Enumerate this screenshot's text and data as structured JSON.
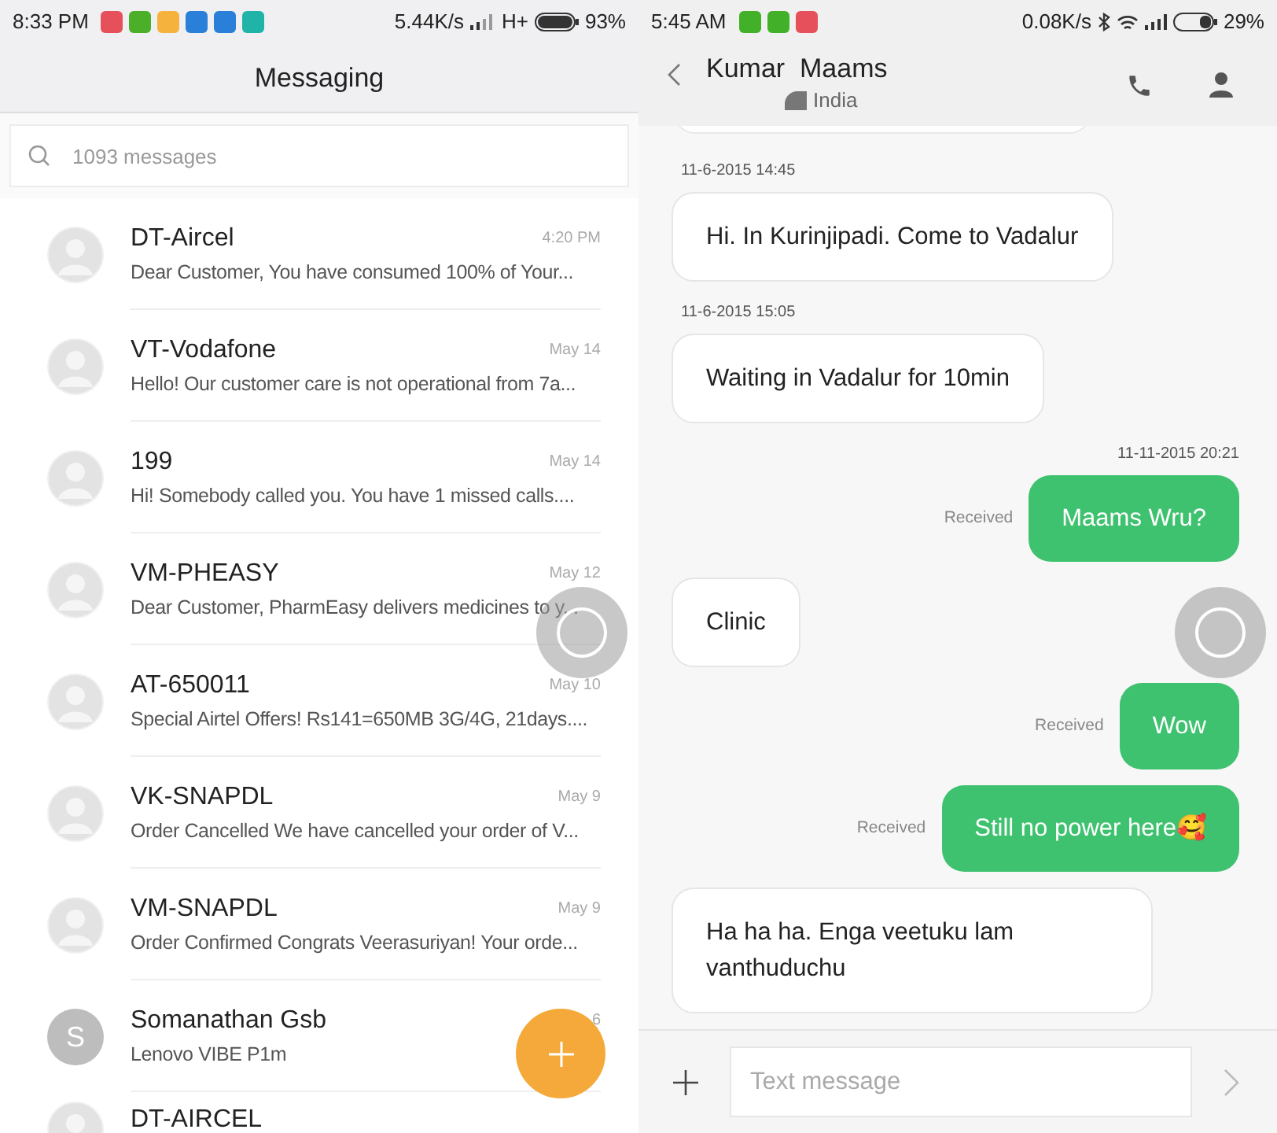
{
  "left_status_bar": {
    "time": "8:33 PM",
    "speed": "5.44K/s",
    "network": "H+",
    "battery": "93%"
  },
  "left_header": {
    "title": "Messaging"
  },
  "search": {
    "placeholder": "1093 messages"
  },
  "conversations": [
    {
      "kind": "silhouette",
      "name": "DT-Aircel",
      "time": "4:20 PM",
      "preview": "Dear Customer, You have consumed 100% of Your..."
    },
    {
      "kind": "silhouette",
      "name": "VT-Vodafone",
      "time": "May 14",
      "preview": "Hello! Our customer care is not operational from 7a..."
    },
    {
      "kind": "silhouette",
      "name": "199",
      "time": "May 14",
      "preview": "Hi! Somebody called you. You have 1 missed calls...."
    },
    {
      "kind": "silhouette",
      "name": "VM-PHEASY",
      "time": "May 12",
      "preview": "Dear Customer, PharmEasy delivers medicines to y..."
    },
    {
      "kind": "silhouette",
      "name": "AT-650011",
      "time": "May 10",
      "preview": "Special Airtel Offers! Rs141=650MB 3G/4G, 21days...."
    },
    {
      "kind": "silhouette",
      "name": "VK-SNAPDL",
      "time": "May 9",
      "preview": "Order Cancelled We have cancelled your order of V..."
    },
    {
      "kind": "silhouette",
      "name": "VM-SNAPDL",
      "time": "May 9",
      "preview": "Order Confirmed Congrats Veerasuriyan! Your orde..."
    },
    {
      "kind": "letter",
      "letter": "S",
      "name": "Somanathan Gsb",
      "time": "6",
      "preview": "Lenovo VIBE P1m"
    },
    {
      "kind": "silhouette",
      "name": "DT-AIRCEL"
    }
  ],
  "right_status_bar": {
    "time": "5:45 AM",
    "speed": "0.08K/s",
    "battery": "29%"
  },
  "contact": {
    "name": "Kumar  Maams",
    "location": "India"
  },
  "messages": [
    {
      "kind": "partial"
    },
    {
      "kind": "incoming",
      "timestamp": "11-6-2015 14:45",
      "text": "Hi. In Kurinjipadi.  Come to Vadalur"
    },
    {
      "kind": "incoming",
      "timestamp": "11-6-2015 15:05",
      "text": "Waiting in Vadalur for 10min"
    },
    {
      "kind": "outgoing",
      "timestamp": "11-11-2015 20:21",
      "status": "Received",
      "text": "Maams Wru?"
    },
    {
      "kind": "incoming",
      "text": "Clinic"
    },
    {
      "kind": "outgoing",
      "status": "Received",
      "text": "Wow"
    },
    {
      "kind": "outgoing",
      "status": "Received",
      "text": "Still no power here🥰"
    },
    {
      "kind": "incoming",
      "text": "Ha ha ha.  Enga veetuku lam vanthuduchu"
    }
  ],
  "composer": {
    "placeholder": "Text message"
  }
}
